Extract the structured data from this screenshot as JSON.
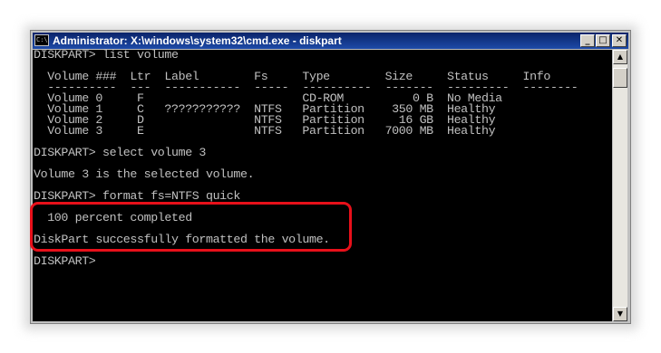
{
  "window": {
    "title": "Administrator: X:\\windows\\system32\\cmd.exe - diskpart",
    "icon_name": "cmd-icon",
    "buttons": {
      "minimize": "_",
      "maximize": "□",
      "close": "✕"
    }
  },
  "console": {
    "lines": [
      "DISKPART> list volume",
      "",
      "  Volume ###  Ltr  Label        Fs     Type        Size     Status     Info",
      "  ----------  ---  -----------  -----  ----------  -------  ---------  --------",
      "  Volume 0     F                       CD-ROM          0 B  No Media",
      "  Volume 1     C   ???????????  NTFS   Partition    350 MB  Healthy",
      "  Volume 2     D                NTFS   Partition     16 GB  Healthy",
      "  Volume 3     E                NTFS   Partition   7000 MB  Healthy",
      "",
      "DISKPART> select volume 3",
      "",
      "Volume 3 is the selected volume.",
      "",
      "DISKPART> format fs=NTFS quick",
      "",
      "  100 percent completed",
      "",
      "DiskPart successfully formatted the volume.",
      "",
      "DISKPART> "
    ]
  },
  "scrollbar": {
    "up_arrow": "▲",
    "down_arrow": "▼"
  },
  "colors": {
    "highlight": "#e8101a",
    "console_bg": "#000000",
    "console_fg": "#c0c0c0"
  }
}
